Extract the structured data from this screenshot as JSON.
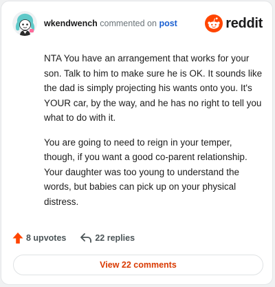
{
  "header": {
    "username": "wkendwench",
    "action_text": "commented on",
    "post_link": "post",
    "avatar_icon": "snoo-avatar-icon",
    "brand_wordmark": "reddit",
    "brand_color": "#ff4500"
  },
  "comment": {
    "paragraphs": [
      "NTA You have an arrangement that works for your son. Talk to him to make sure he is OK. It sounds like the dad is simply projecting his wants onto you. It's YOUR car, by the way, and he has no right to tell you what to do with it.",
      "You are going to need to reign in your temper, though, if you want a good co-parent relationship. Your daughter was too young to understand the words, but babies can pick up on your physical distress."
    ]
  },
  "actions": {
    "upvotes_label": "8 upvotes",
    "replies_label": "22 replies",
    "upvote_icon": "upvote-arrow-icon",
    "reply_icon": "reply-arrow-icon",
    "upvote_color": "#ff4500"
  },
  "footer": {
    "view_comments_label": "View 22 comments",
    "link_color": "#d93900"
  }
}
